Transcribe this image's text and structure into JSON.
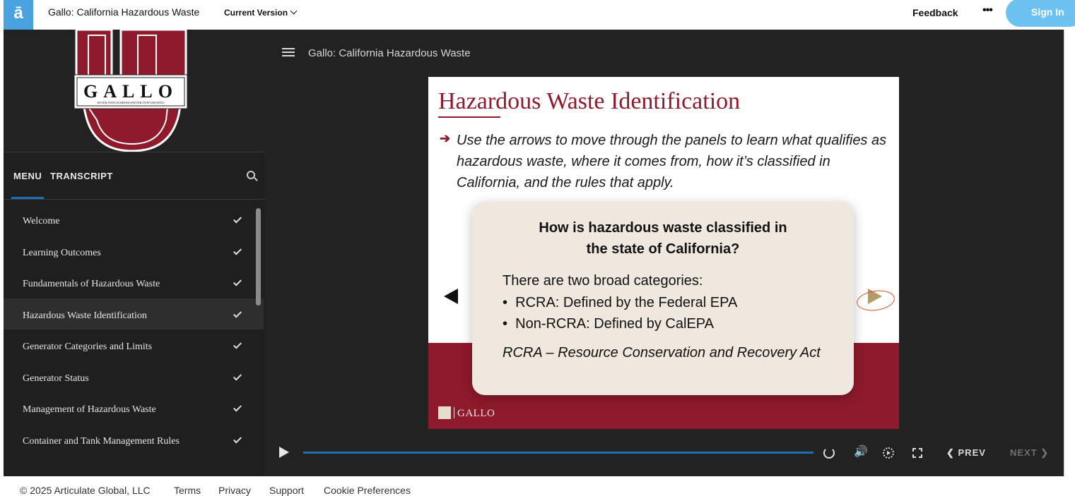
{
  "topbar": {
    "logo_glyph": "ā",
    "course_title": "Gallo: California Hazardous Waste",
    "version_label": "Current Version",
    "feedback_label": "Feedback",
    "more_label": "•••",
    "signin_label": "Sign In",
    "accent_color": "#4aa3df"
  },
  "brand": {
    "logo_text": "GALLO",
    "tagline": "NEVER STOP LEARNING•NEVER STOP GROWING",
    "brand_color": "#8e1a2b"
  },
  "sidebar": {
    "tabs": [
      {
        "label": "MENU"
      },
      {
        "label": "TRANSCRIPT"
      }
    ],
    "items": [
      {
        "label": "Welcome",
        "done": true
      },
      {
        "label": "Learning Outcomes",
        "done": true
      },
      {
        "label": "Fundamentals of Hazardous Waste",
        "done": true
      },
      {
        "label": "Hazardous Waste Identification",
        "done": true,
        "active": true
      },
      {
        "label": "Generator Categories and Limits",
        "done": true
      },
      {
        "label": "Generator Status",
        "done": true
      },
      {
        "label": "Management of Hazardous Waste",
        "done": true
      },
      {
        "label": "Container and Tank Management Rules",
        "done": true
      }
    ]
  },
  "player": {
    "title": "Gallo: California Hazardous Waste",
    "prev_label": "PREV",
    "next_label": "NEXT"
  },
  "slide": {
    "title": "Hazardous Waste Identification",
    "instructions": "Use the arrows to move through the panels to learn what qualifies as hazardous waste, where it comes from, how it’s classified in California, and the rules that apply.",
    "card": {
      "question_line1": "How is hazardous waste classified in",
      "question_line2": "the state of California?",
      "intro": "There are two broad categories:",
      "bullets": [
        "RCRA: Defined by the Federal EPA",
        "Non-RCRA: Defined by CalEPA"
      ],
      "note": "RCRA – Resource Conservation and Recovery Act"
    },
    "footer_logo": "GALLO"
  },
  "footer": {
    "copyright": "© 2025 Articulate Global, LLC",
    "links": [
      "Terms",
      "Privacy",
      "Support",
      "Cookie Preferences"
    ]
  }
}
